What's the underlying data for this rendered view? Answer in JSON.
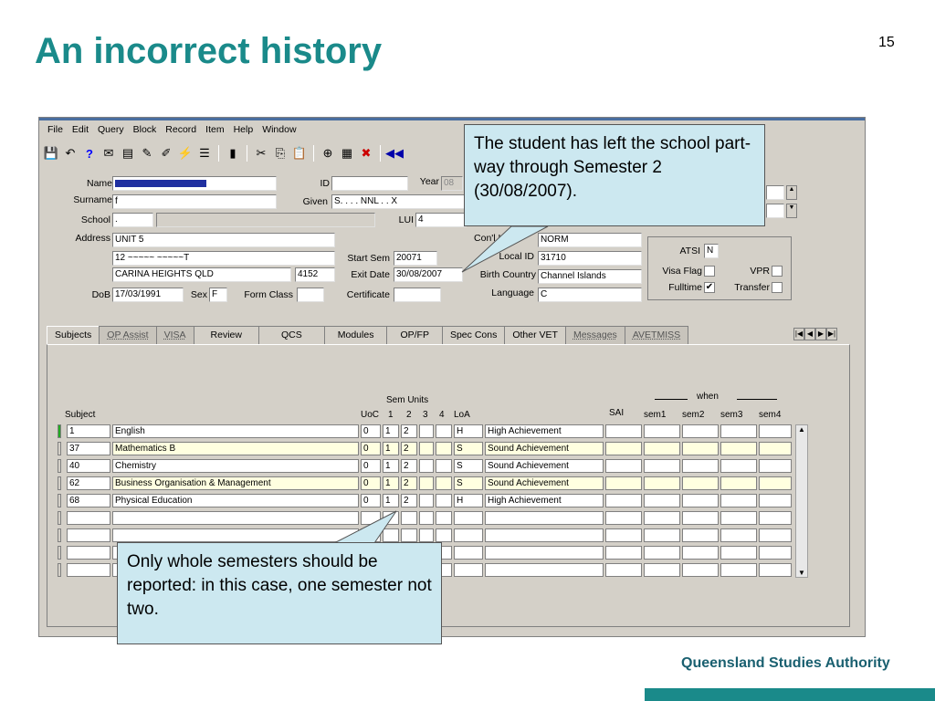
{
  "slide": {
    "title": "An incorrect history",
    "number": "15",
    "brand": "Queensland Studies Authority"
  },
  "menu": [
    "File",
    "Edit",
    "Query",
    "Block",
    "Record",
    "Item",
    "Help",
    "Window"
  ],
  "form": {
    "name_label": "Name",
    "surname_label": "Surname",
    "surname_value": "f",
    "school_label": "School",
    "school_value": ".",
    "address_label": "Address",
    "address_line1": "UNIT 5",
    "address_line2": "12 ~~~~~ ~~~~~T",
    "address_line3": "CARINA HEIGHTS QLD",
    "postcode": "4152",
    "dob_label": "DoB",
    "dob_value": "17/03/1991",
    "sex_label": "Sex",
    "sex_value": "F",
    "form_class_label": "Form Class",
    "id_label": "ID",
    "year_label": "Year",
    "year_value": "08",
    "given_label": "Given",
    "given_value": "S. . . . NNL . .  X",
    "lui_label": "LUI",
    "lui_value": "4",
    "start_sem_label": "Start Sem",
    "start_sem_value": "20071",
    "exit_date_label": "Exit Date",
    "exit_date_value": "30/08/2007",
    "certificate_label": "Certificate",
    "conunit_label": "Con'l Un",
    "conunit_value": "NORM",
    "localid_label": "Local ID",
    "localid_value": "31710",
    "birthcountry_label": "Birth Country",
    "birthcountry_value": "Channel Islands",
    "language_label": "Language",
    "language_value": "C",
    "atsi_label": "ATSI",
    "atsi_value": "N",
    "visaflag_label": "Visa Flag",
    "vpr_label": "VPR",
    "fulltime_label": "Fulltime",
    "fulltime_value": "✔",
    "transfer_label": "Transfer"
  },
  "tabs": [
    "Subjects",
    "OP Assist",
    "VISA",
    "Review",
    "QCS",
    "Modules",
    "OP/FP",
    "Spec Cons",
    "Other VET",
    "Messages",
    "AVETMISS"
  ],
  "table": {
    "sem_units_label": "Sem Units",
    "when_label": "when",
    "headers": [
      "Subject",
      "UoC",
      "1",
      "2",
      "3",
      "4",
      "LoA",
      "SAI",
      "sem1",
      "sem2",
      "sem3",
      "sem4"
    ],
    "rows": [
      {
        "code": "1",
        "name": "English",
        "uoc": "0",
        "s1": "1",
        "s2": "2",
        "loa": "H",
        "desc": "High Achievement"
      },
      {
        "code": "37",
        "name": "Mathematics B",
        "uoc": "0",
        "s1": "1",
        "s2": "2",
        "loa": "S",
        "desc": "Sound Achievement"
      },
      {
        "code": "40",
        "name": "Chemistry",
        "uoc": "0",
        "s1": "1",
        "s2": "2",
        "loa": "S",
        "desc": "Sound Achievement"
      },
      {
        "code": "62",
        "name": "Business Organisation & Management",
        "uoc": "0",
        "s1": "1",
        "s2": "2",
        "loa": "S",
        "desc": "Sound Achievement"
      },
      {
        "code": "68",
        "name": "Physical Education",
        "uoc": "0",
        "s1": "1",
        "s2": "2",
        "loa": "H",
        "desc": "High Achievement"
      }
    ]
  },
  "callouts": {
    "exit": "The student has left the school part-way through Semester 2 (30/08/2007).",
    "units": "Only whole semesters should be reported: in this case, one semester not two."
  }
}
